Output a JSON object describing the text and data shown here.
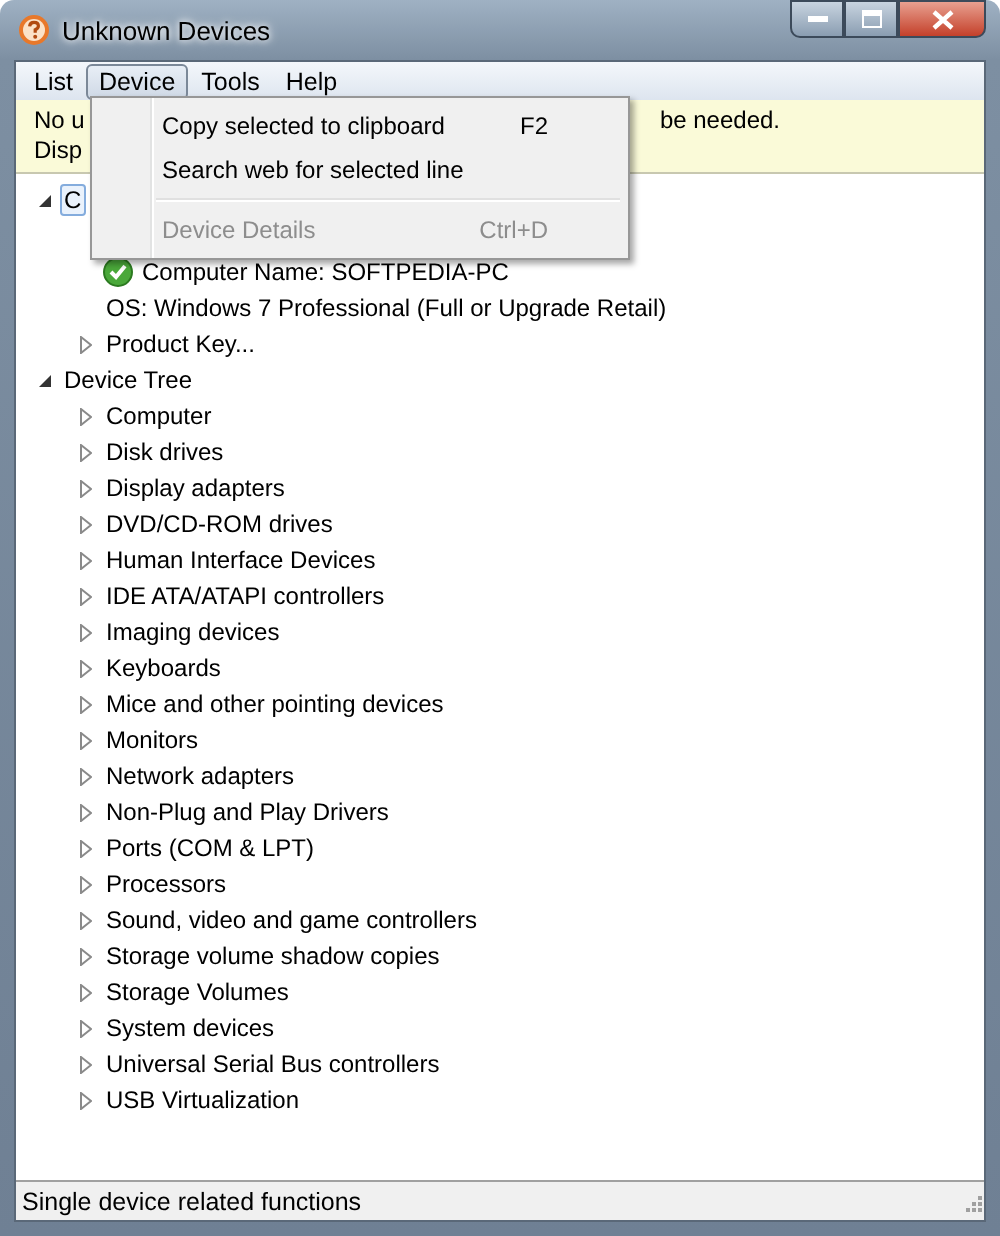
{
  "window": {
    "title": "Unknown Devices"
  },
  "menu_bar": [
    {
      "label": "List",
      "selected": false
    },
    {
      "label": "Device",
      "selected": true
    },
    {
      "label": "Tools",
      "selected": false
    },
    {
      "label": "Help",
      "selected": false
    }
  ],
  "info_bar": {
    "line_1_start": "No u",
    "line_1_end": "be needed.",
    "line_2": "Disp"
  },
  "open_menu": [
    {
      "kind": "item",
      "label": "Copy selected to clipboard",
      "shortcut": "F2",
      "disabled": false
    },
    {
      "kind": "item",
      "label": "Search web for selected line",
      "disabled": false
    },
    {
      "kind": "separator"
    },
    {
      "kind": "item",
      "label": "Device Details",
      "shortcut": "Ctrl+D",
      "disabled": true
    }
  ],
  "tree": [
    {
      "kind": "branch",
      "label": "C",
      "expanded": true,
      "selected": true,
      "children": [
        {
          "kind": "status-leaf",
          "label": "Computer Name: SOFTPEDIA-PC",
          "selected": false
        },
        {
          "kind": "leaf",
          "label": "OS: Windows 7 Professional  (Full or Upgrade Retail)",
          "selected": false
        },
        {
          "kind": "branch",
          "label": "Product Key...",
          "expanded": false,
          "selected": false
        }
      ]
    },
    {
      "kind": "branch",
      "label": "Device Tree",
      "expanded": true,
      "selected": false,
      "children": [
        {
          "kind": "branch",
          "label": "Computer",
          "expanded": false,
          "selected": false
        },
        {
          "kind": "branch",
          "label": "Disk drives",
          "expanded": false,
          "selected": false
        },
        {
          "kind": "branch",
          "label": "Display adapters",
          "expanded": false,
          "selected": false
        },
        {
          "kind": "branch",
          "label": "DVD/CD-ROM drives",
          "expanded": false,
          "selected": false
        },
        {
          "kind": "branch",
          "label": "Human Interface Devices",
          "expanded": false,
          "selected": false
        },
        {
          "kind": "branch",
          "label": "IDE ATA/ATAPI controllers",
          "expanded": false,
          "selected": false
        },
        {
          "kind": "branch",
          "label": "Imaging devices",
          "expanded": false,
          "selected": false
        },
        {
          "kind": "branch",
          "label": "Keyboards",
          "expanded": false,
          "selected": false
        },
        {
          "kind": "branch",
          "label": "Mice and other pointing devices",
          "expanded": false,
          "selected": false
        },
        {
          "kind": "branch",
          "label": "Monitors",
          "expanded": false,
          "selected": false
        },
        {
          "kind": "branch",
          "label": "Network adapters",
          "expanded": false,
          "selected": false
        },
        {
          "kind": "branch",
          "label": "Non-Plug and Play Drivers",
          "expanded": false,
          "selected": false
        },
        {
          "kind": "branch",
          "label": "Ports (COM & LPT)",
          "expanded": false,
          "selected": false
        },
        {
          "kind": "branch",
          "label": "Processors",
          "expanded": false,
          "selected": false
        },
        {
          "kind": "branch",
          "label": "Sound, video and game controllers",
          "expanded": false,
          "selected": false
        },
        {
          "kind": "branch",
          "label": "Storage volume shadow copies",
          "expanded": false,
          "selected": false
        },
        {
          "kind": "branch",
          "label": "Storage Volumes",
          "expanded": false,
          "selected": false
        },
        {
          "kind": "branch",
          "label": "System devices",
          "expanded": false,
          "selected": false
        },
        {
          "kind": "branch",
          "label": "Universal Serial Bus controllers",
          "expanded": false,
          "selected": false
        },
        {
          "kind": "branch",
          "label": "USB Virtualization",
          "expanded": false,
          "selected": false
        }
      ]
    }
  ],
  "status_bar": "Single device related functions"
}
